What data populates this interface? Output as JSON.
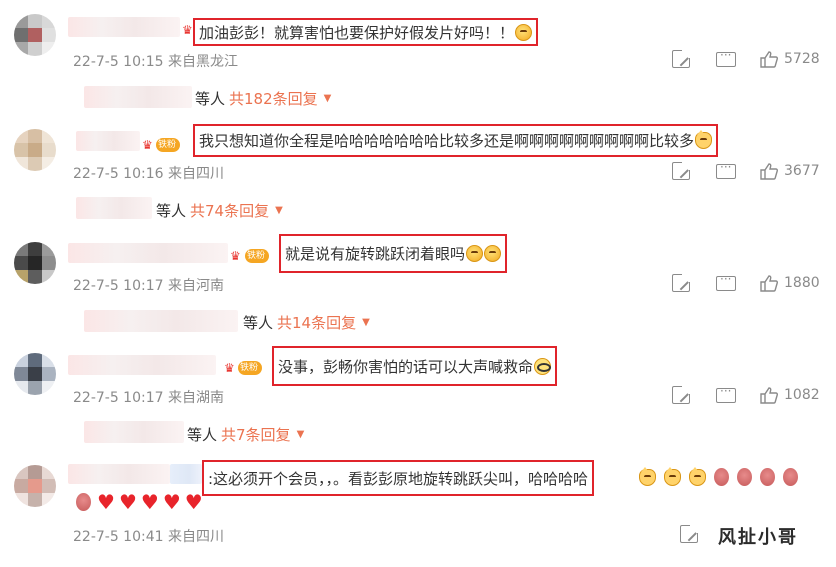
{
  "comments": [
    {
      "text": "加油彭彭！就算害怕也要保护好假发片好吗！！",
      "time": "22-7-5 10:15",
      "location": "来自黑龙江",
      "likes": "5728",
      "replies_deng": "等人",
      "replies_count": "共182条回复"
    },
    {
      "badge": "铁粉",
      "text": "我只想知道你全程是哈哈哈哈哈哈哈比较多还是啊啊啊啊啊啊啊啊啊比较多",
      "time": "22-7-5 10:16",
      "location": "来自四川",
      "likes": "3677",
      "replies_deng": "等人",
      "replies_count": "共74条回复"
    },
    {
      "badge": "铁粉",
      "text": "就是说有旋转跳跃闭着眼吗",
      "time": "22-7-5 10:17",
      "location": "来自河南",
      "likes": "1880",
      "replies_deng": "等人",
      "replies_count": "共14条回复"
    },
    {
      "badge": "铁粉",
      "text": "没事，彭畅你害怕的话可以大声喊救命",
      "time": "22-7-5 10:17",
      "location": "来自湖南",
      "likes": "1082",
      "replies_deng": "等人",
      "replies_count": "共7条回复"
    },
    {
      "text": ":这必须开个会员，，。看彭彭原地旋转跳跃尖叫，哈哈哈哈",
      "time": "22-7-5 10:41",
      "location": "来自四川"
    }
  ],
  "watermark": "风扯小哥",
  "colors": {
    "highlight_border": "#e0242b",
    "reply_link": "#eb7350",
    "meta_gray": "#8a8a8a"
  },
  "icons": [
    "share-icon",
    "comment-icon",
    "like-icon",
    "caret-down-icon",
    "heart-icon",
    "emoji-icon"
  ]
}
